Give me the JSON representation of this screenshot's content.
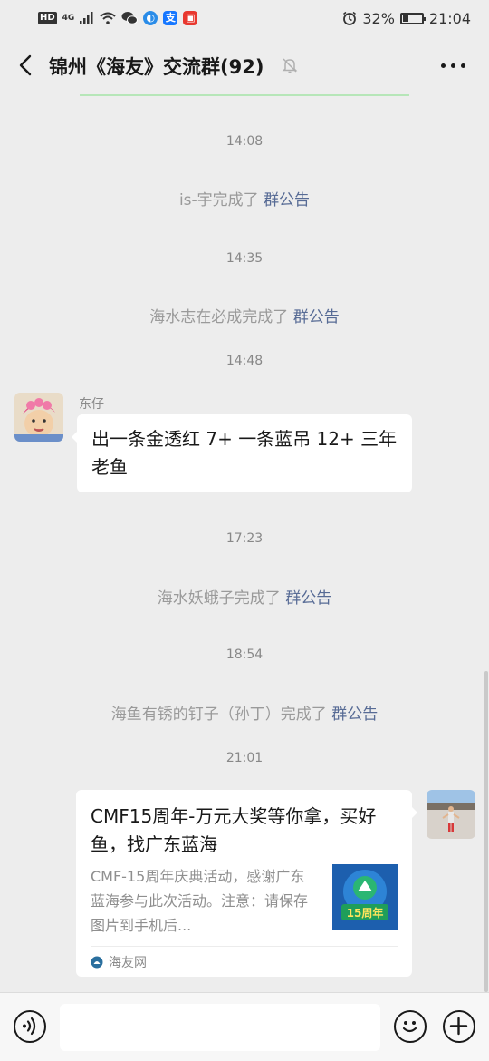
{
  "status_bar": {
    "hd": "HD",
    "network": "4G",
    "battery_percent": "32%",
    "battery_level": 0.32,
    "time": "21:04"
  },
  "header": {
    "title": "锦州《海友》交流群(92)",
    "back_icon": "chevron-left-icon",
    "mute_icon": "bell-off-icon",
    "more_icon": "more-horizontal-icon"
  },
  "messages": [
    {
      "type": "time",
      "text": "14:08"
    },
    {
      "type": "system",
      "prefix": "is-宇完成了 ",
      "link": "群公告"
    },
    {
      "type": "time",
      "text": "14:35"
    },
    {
      "type": "system",
      "prefix": "海水志在必成完成了 ",
      "link": "群公告"
    },
    {
      "type": "time",
      "text": "14:48"
    },
    {
      "type": "text",
      "sender": "东仔",
      "text": "出一条金透红 7+ 一条蓝吊 12+ 三年老鱼"
    },
    {
      "type": "time",
      "text": "17:23"
    },
    {
      "type": "system",
      "prefix": "海水妖蛾子完成了 ",
      "link": "群公告"
    },
    {
      "type": "time",
      "text": "18:54"
    },
    {
      "type": "system",
      "prefix": "海鱼有锈的钉子（孙丁）完成了 ",
      "link": "群公告"
    },
    {
      "type": "time",
      "text": "21:01"
    },
    {
      "type": "card",
      "title": "CMF15周年-万元大奖等你拿，买好鱼，找广东蓝海",
      "description": "CMF-15周年庆典活动，感谢广东蓝海参与此次活动。注意：请保存图片到手机后...",
      "thumb_text": "15周年",
      "source": "海友网"
    }
  ],
  "input_bar": {
    "voice_icon": "voice-icon",
    "emoji_icon": "smiley-icon",
    "plus_icon": "plus-circle-icon",
    "placeholder": ""
  },
  "colors": {
    "background": "#ededed",
    "link": "#576b95",
    "bubble": "#ffffff"
  }
}
